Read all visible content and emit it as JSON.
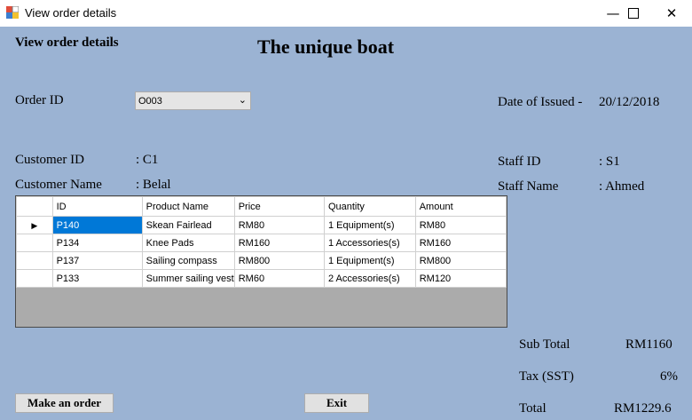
{
  "window": {
    "title": "View order details"
  },
  "form": {
    "heading": "View order details",
    "brand": "The unique boat",
    "order_id_label": "Order ID",
    "order_id_value": "O003",
    "date_issued_label": "Date of Issued -",
    "date_issued_value": "20/12/2018",
    "customer_id_label": "Customer ID",
    "customer_id_value": ": C1",
    "customer_name_label": "Customer Name",
    "customer_name_value": ": Belal",
    "staff_id_label": "Staff ID",
    "staff_id_value": ": S1",
    "staff_name_label": "Staff Name",
    "staff_name_value": ": Ahmed"
  },
  "grid": {
    "columns": [
      "ID",
      "Product Name",
      "Price",
      "Quantity",
      "Amount"
    ],
    "rows": [
      {
        "id": "P140",
        "product": "Skean Fairlead",
        "price": "RM80",
        "quantity": "1  Equipment(s)",
        "amount": "RM80"
      },
      {
        "id": "P134",
        "product": "Knee Pads",
        "price": "RM160",
        "quantity": "1  Accessories(s)",
        "amount": "RM160"
      },
      {
        "id": "P137",
        "product": "Sailing compass",
        "price": "RM800",
        "quantity": "1  Equipment(s)",
        "amount": "RM800"
      },
      {
        "id": "P133",
        "product": "Summer sailing vest",
        "price": "RM60",
        "quantity": "2  Accessories(s)",
        "amount": "RM120"
      }
    ]
  },
  "totals": {
    "subtotal_label": "Sub Total",
    "subtotal_value": "RM1160",
    "tax_label": "Tax (SST)",
    "tax_value": "6%",
    "total_label": "Total",
    "total_value": "RM1229.6"
  },
  "buttons": {
    "make_order": "Make an order",
    "exit": "Exit"
  },
  "icons": {
    "minimize": "minimize-icon",
    "maximize": "maximize-icon",
    "close": "close-icon",
    "dropdown": "chevron-down-icon",
    "row_pointer": "row-pointer-icon"
  },
  "colors": {
    "form_background": "#9bb3d3",
    "selection": "#0078d7",
    "grid_background": "#ababab"
  }
}
